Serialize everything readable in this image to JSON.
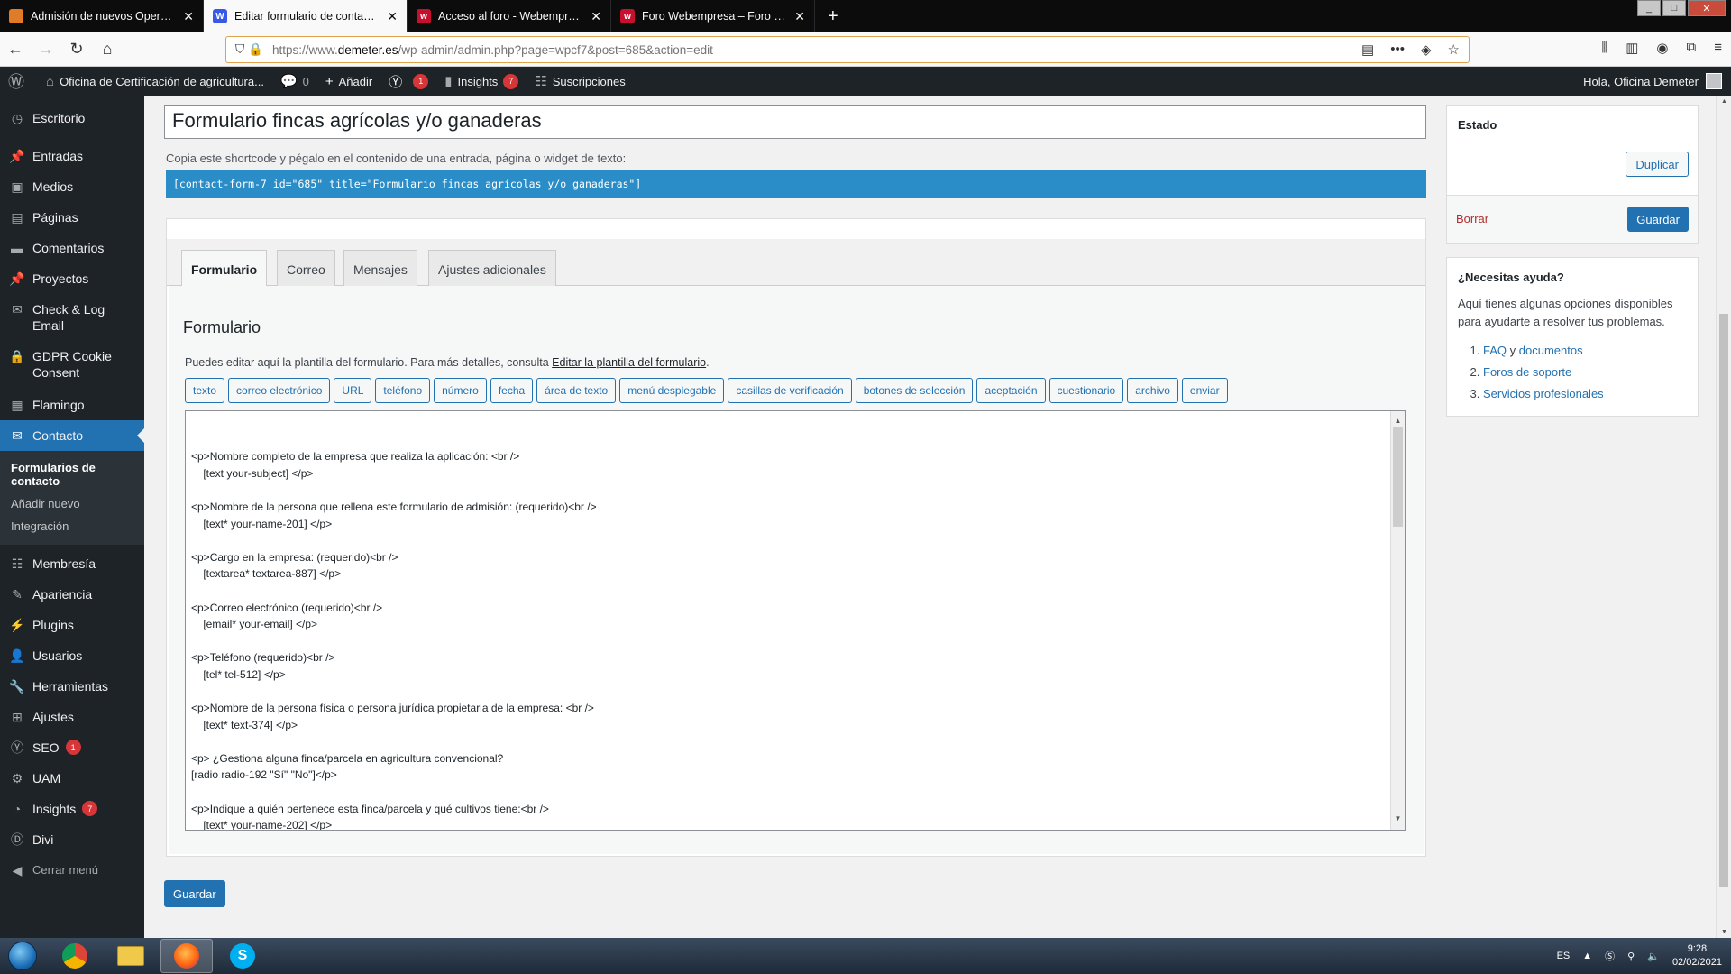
{
  "browser": {
    "tabs": [
      {
        "title": "Admisión de nuevos Operadores",
        "favicon_color": "#e07b28",
        "favicon_text": "",
        "active": false
      },
      {
        "title": "Editar formulario de contacto ‹ Oficina",
        "favicon_color": "#3858e9",
        "favicon_text": "W",
        "active": true
      },
      {
        "title": "Acceso al foro - Webempresa",
        "favicon_color": "#c8102e",
        "favicon_text": "w",
        "active": false
      },
      {
        "title": "Foro Webempresa – Foro WordPress",
        "favicon_color": "#c8102e",
        "favicon_text": "w",
        "active": false
      }
    ],
    "new_tab": "+",
    "url_domain_prefix": "https://www.",
    "url_domain": "demeter.es",
    "url_path": "/wp-admin/admin.php?page=wpcf7&post=685&action=edit"
  },
  "adminbar": {
    "site_name": "Oficina de Certificación de agricultura...",
    "comments_count": "0",
    "add_label": "Añadir",
    "yoast_badge": "1",
    "insights_label": "Insights",
    "insights_badge": "7",
    "subscriptions_label": "Suscripciones",
    "greeting": "Hola, Oficina Demeter"
  },
  "sidebar": {
    "items": [
      {
        "label": "Escritorio",
        "icon": "dashboard-icon"
      },
      {
        "label": "Entradas",
        "icon": "pin-icon"
      },
      {
        "label": "Medios",
        "icon": "media-icon"
      },
      {
        "label": "Páginas",
        "icon": "pages-icon"
      },
      {
        "label": "Comentarios",
        "icon": "comments-icon"
      },
      {
        "label": "Proyectos",
        "icon": "pin-icon"
      },
      {
        "label": "Check & Log Email",
        "icon": "email-icon"
      },
      {
        "label": "GDPR Cookie Consent",
        "icon": "lock-icon"
      },
      {
        "label": "Flamingo",
        "icon": "flamingo-icon"
      },
      {
        "label": "Contacto",
        "icon": "envelope-icon"
      }
    ],
    "sub_current": "Formularios de contacto",
    "sub_add": "Añadir nuevo",
    "sub_integration": "Integración",
    "items2": [
      {
        "label": "Membresía",
        "icon": "groups-icon"
      },
      {
        "label": "Apariencia",
        "icon": "brush-icon"
      },
      {
        "label": "Plugins",
        "icon": "plugin-icon"
      },
      {
        "label": "Usuarios",
        "icon": "user-icon"
      },
      {
        "label": "Herramientas",
        "icon": "wrench-icon"
      },
      {
        "label": "Ajustes",
        "icon": "settings-icon"
      }
    ],
    "seo_label": "SEO",
    "seo_badge": "1",
    "uam_label": "UAM",
    "insights_label": "Insights",
    "insights_badge": "7",
    "divi_label": "Divi",
    "collapse_label": "Cerrar menú"
  },
  "form": {
    "title": "Formulario fincas agrícolas y/o ganaderas",
    "shortcode_label": "Copia este shortcode y pégalo en el contenido de una entrada, página o widget de texto:",
    "shortcode": "[contact-form-7 id=\"685\" title=\"Formulario fincas agrícolas y/o ganaderas\"]",
    "tabs": [
      "Formulario",
      "Correo",
      "Mensajes",
      "Ajustes adicionales"
    ],
    "panel_title": "Formulario",
    "desc_text": "Puedes editar aquí la plantilla del formulario. Para más detalles, consulta ",
    "desc_link": "Editar la plantilla del formulario",
    "desc_end": ".",
    "tag_buttons": [
      "texto",
      "correo electrónico",
      "URL",
      "teléfono",
      "número",
      "fecha",
      "área de texto",
      "menú desplegable",
      "casillas de verificación",
      "botones de selección",
      "aceptación",
      "cuestionario",
      "archivo",
      "enviar"
    ],
    "template": "<p>Nombre completo de la empresa que realiza la aplicación: <br />\n    [text your-subject] </p>\n\n<p>Nombre de la persona que rellena este formulario de admisión: (requerido)<br />\n    [text* your-name-201] </p>\n\n<p>Cargo en la empresa: (requerido)<br />\n    [textarea* textarea-887] </p>\n\n<p>Correo electrónico (requerido)<br />\n    [email* your-email] </p>\n\n<p>Teléfono (requerido)<br />\n    [tel* tel-512] </p>\n\n<p>Nombre de la persona física o persona jurídica propietaria de la empresa: <br />\n    [text* text-374] </p>\n\n<p> ¿Gestiona alguna finca/parcela en agricultura convencional?\n[radio radio-192 \"Sí\" \"No\"]</p>\n\n<p>Indique a quién pertenece esta finca/parcela y qué cultivos tiene:<br />\n    [text* your-name-202] </p>\n\n<p> ¿Es propietario de alguna finca/parcela en agricultura convencional?",
    "save_label": "Guardar"
  },
  "status_box": {
    "title": "Estado",
    "duplicate_label": "Duplicar",
    "delete_label": "Borrar",
    "save_label": "Guardar"
  },
  "help_box": {
    "title": "¿Necesitas ayuda?",
    "text": "Aquí tienes algunas opciones disponibles para ayudarte a resolver tus problemas.",
    "faq": "FAQ",
    "and": " y ",
    "docs": "documentos",
    "forums": "Foros de soporte",
    "services": "Servicios profesionales"
  },
  "taskbar": {
    "lang": "ES",
    "time": "9:28",
    "date": "02/02/2021"
  }
}
